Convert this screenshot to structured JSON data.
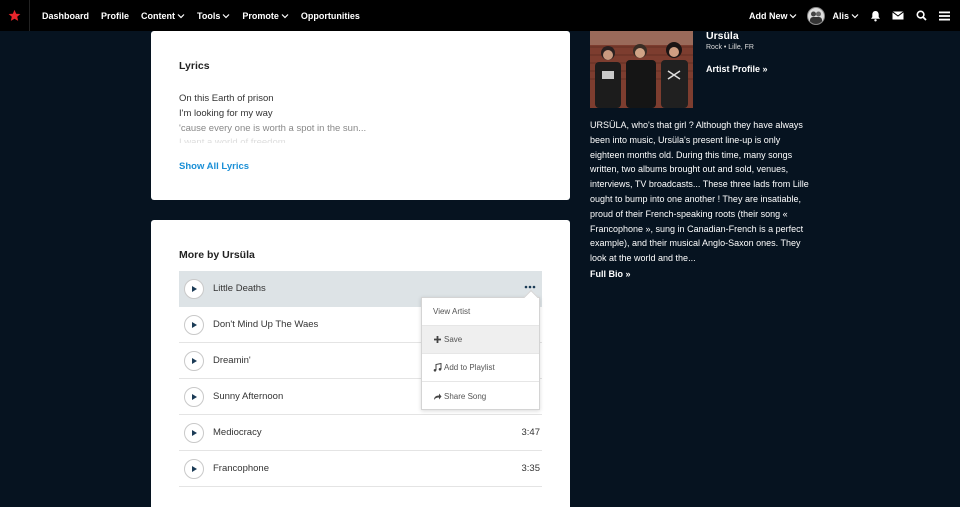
{
  "nav": {
    "items": [
      {
        "label": "Dashboard",
        "dropdown": false
      },
      {
        "label": "Profile",
        "dropdown": false
      },
      {
        "label": "Content",
        "dropdown": true
      },
      {
        "label": "Tools",
        "dropdown": true
      },
      {
        "label": "Promote",
        "dropdown": true
      },
      {
        "label": "Opportunities",
        "dropdown": false
      }
    ],
    "add_new": "Add New",
    "user": "Alis",
    "icons": [
      "bell-icon",
      "mail-icon",
      "search-icon",
      "menu-icon"
    ],
    "accent": "#e8252b"
  },
  "lyrics": {
    "title": "Lyrics",
    "lines": [
      "On this Earth of prison",
      "I'm looking for my way",
      "'cause every one is worth a spot in the sun...",
      "I want a world of freedom"
    ],
    "show_all": "Show All Lyrics"
  },
  "more": {
    "title": "More by Ursüla",
    "songs": [
      {
        "title": "Little Deaths",
        "duration": ""
      },
      {
        "title": "Don't Mind Up The Waes",
        "duration": ""
      },
      {
        "title": "Dreamin'",
        "duration": ""
      },
      {
        "title": "Sunny Afternoon",
        "duration": ""
      },
      {
        "title": "Mediocracy",
        "duration": "3:47"
      },
      {
        "title": "Francophone",
        "duration": "3:35"
      }
    ],
    "menu": {
      "view_artist": "View Artist",
      "save": "Save",
      "add_to_playlist": "Add to Playlist",
      "share_song": "Share Song"
    }
  },
  "artist": {
    "name": "Ursüla",
    "meta": "Rock • Lille, FR",
    "profile_link": "Artist Profile »",
    "bio": "URSÜLA, who's that girl ? Although they have always been into music, Ursüla's present line-up is only eighteen months old. During this time, many songs written, two albums brought out and sold, venues, interviews, TV broadcasts... These three lads from Lille ought to bump into one another ! They are insatiable, proud of their French-speaking roots (their song « Francophone », sung in Canadian-French is a perfect example), and their musical Anglo-Saxon ones. They look at the world and the...",
    "full_bio": "Full Bio »"
  }
}
